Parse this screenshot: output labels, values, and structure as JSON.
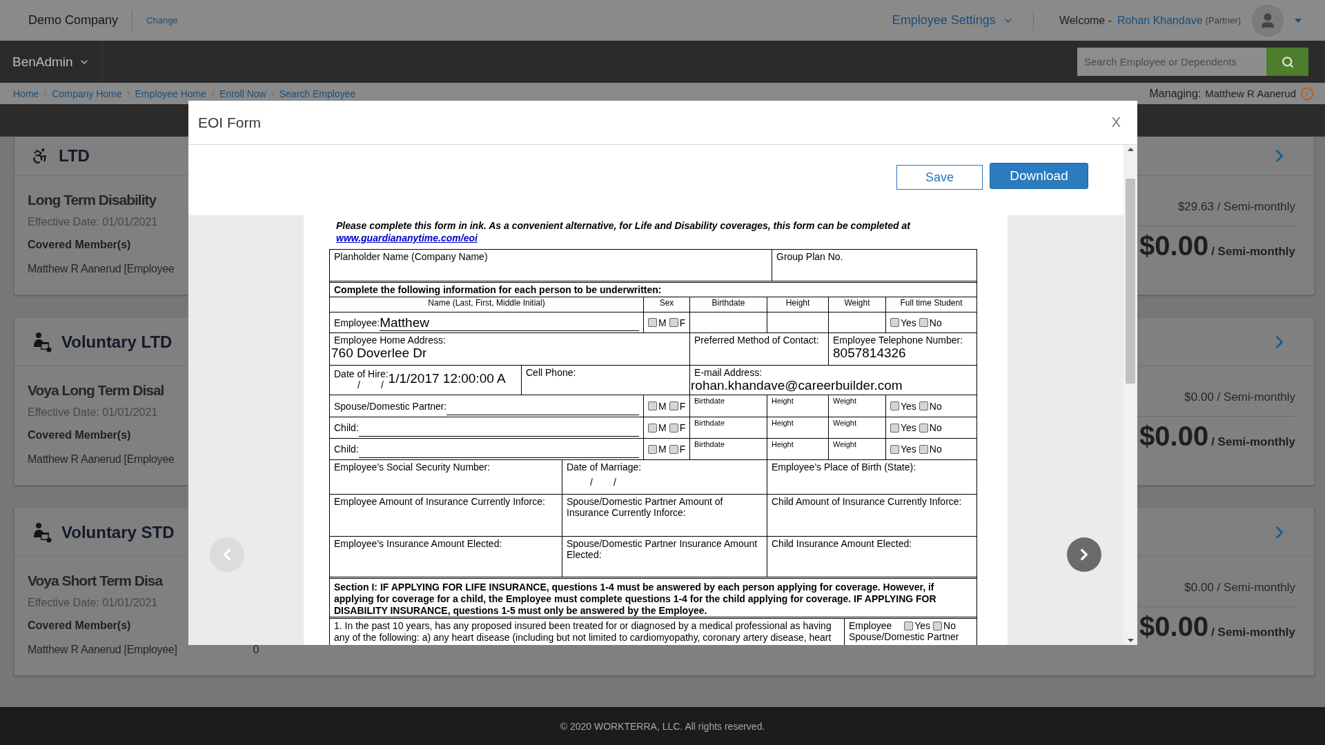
{
  "top_bar": {
    "company": "Demo Company",
    "change_link": "Change",
    "settings_menu": "Employee Settings",
    "welcome": "Welcome -",
    "user_name": "Rohan Khandave",
    "user_role": "(Partner)"
  },
  "nav_bar": {
    "app_menu": "BenAdmin",
    "search": {
      "placeholder": "Search Employee or Dependents"
    }
  },
  "breadcrumbs": [
    "Home",
    "Company Home",
    "Employee Home",
    "Enroll Now",
    "Search Employee"
  ],
  "managing": {
    "label": "Managing:",
    "name": "Matthew R Aanerud"
  },
  "plans": [
    {
      "category": "LTD",
      "plan_name": "Long Term Disability",
      "effective": "Effective Date: 01/01/2021",
      "members_heading": "Covered Member(s)",
      "member": "Matthew R Aanerud [Employee",
      "premium": "$29.63 / Semi-monthly",
      "contribution_amount": "$0.00",
      "contribution_period": "/ Semi-monthly"
    },
    {
      "category": "Voluntary LTD",
      "plan_name": "Voya Long Term Disal",
      "effective": "Effective Date: 01/01/2021",
      "members_heading": "Covered Member(s)",
      "member": "Matthew R Aanerud [Employee",
      "premium": "$0.00 / Semi-monthly",
      "contribution_amount": "$0.00",
      "contribution_period": "/ Semi-monthly"
    },
    {
      "category": "Voluntary STD",
      "plan_name": "Voya Short Term Disa",
      "effective": "Effective Date: 01/01/2021",
      "members_heading": "Covered Member(s)",
      "member": "Matthew R Aanerud [Employee]",
      "member_value": "0",
      "premium": "$0.00 / Semi-monthly",
      "contribution_amount": "$0.00",
      "contribution_period": "/ Semi-monthly"
    }
  ],
  "modal": {
    "title": "EOI Form",
    "close": "X",
    "save": "Save",
    "download": "Download",
    "form": {
      "intro": "Please complete this form in ink.  As a convenient alternative, for Life and Disability coverages, this form can be completed at",
      "link": "www.guardiananytime.com/eoi",
      "planholder_label": "Planholder Name (Company Name)",
      "group_plan_label": "Group Plan No.",
      "persons_heading": "Complete the following information for each person to be underwritten:",
      "columns": [
        "Name (Last, First, Middle Initial)",
        "Sex",
        "Birthdate",
        "Height",
        "Weight",
        "Full time Student"
      ],
      "employee": {
        "label": "Employee:",
        "name": "Matthew",
        "sex": [
          {
            "label": "M",
            "checked": false
          },
          {
            "label": "F",
            "checked": false
          }
        ],
        "student": [
          {
            "label": "Yes",
            "checked": false
          },
          {
            "label": "No",
            "checked": false
          }
        ]
      },
      "address_label": "Employee Home Address:",
      "address": "760 Doverlee Dr",
      "contact_label": "Preferred Method of Contact:",
      "phone_label": "Employee Telephone Number:",
      "phone": "8057814326",
      "hire_label": "Date of Hire:",
      "hire_marks": [
        "/",
        "/"
      ],
      "hire_date": "1/1/2017 12:00:00 A",
      "cell_label": "Cell Phone:",
      "email_label": "E-mail Address:",
      "email": "rohan.khandave@careerbuilder.com",
      "dependents": [
        {
          "label": "Spouse/Domestic Partner:",
          "sex": [
            {
              "label": "M",
              "checked": false
            },
            {
              "label": "F",
              "checked": false
            }
          ],
          "fields": [
            "Birthdate",
            "Height",
            "Weight"
          ],
          "student": [
            {
              "label": "Yes",
              "checked": false
            },
            {
              "label": "No",
              "checked": false
            }
          ]
        },
        {
          "label": "Child:",
          "sex": [
            {
              "label": "M",
              "checked": false
            },
            {
              "label": "F",
              "checked": false
            }
          ],
          "fields": [
            "Birthdate",
            "Height",
            "Weight"
          ],
          "student": [
            {
              "label": "Yes",
              "checked": false
            },
            {
              "label": "No",
              "checked": false
            }
          ]
        },
        {
          "label": "Child:",
          "sex": [
            {
              "label": "M",
              "checked": false
            },
            {
              "label": "F",
              "checked": false
            }
          ],
          "fields": [
            "Birthdate",
            "Height",
            "Weight"
          ],
          "student": [
            {
              "label": "Yes",
              "checked": false
            },
            {
              "label": "No",
              "checked": false
            }
          ]
        }
      ],
      "info_rows": [
        [
          {
            "label": "Employee’s Social Security Number:"
          },
          {
            "label": "Date of Marriage:",
            "marks": [
              "/",
              "/"
            ]
          },
          {
            "label": "Employee’s Place of Birth (State):"
          }
        ],
        [
          {
            "label": "Employee Amount of Insurance Currently Inforce:"
          },
          {
            "label": "Spouse/Domestic Partner Amount of Insurance Currently Inforce:"
          },
          {
            "label": "Child Amount of Insurance Currently Inforce:"
          }
        ],
        [
          {
            "label": "Employee’s Insurance Amount Elected:"
          },
          {
            "label": "Spouse/Domestic Partner Insurance Amount Elected:"
          },
          {
            "label": "Child Insurance Amount Elected:"
          }
        ]
      ],
      "section_heading": "Section I: IF APPLYING FOR LIFE INSURANCE, questions 1-4 must be answered by each person applying for coverage.  However, if applying for coverage for a child, the Employee must complete questions 1-4 for the child applying for coverage. IF APPLYING FOR DISABILITY INSURANCE, questions 1-5 must only be answered by the Employee.",
      "questions": [
        {
          "number": "1.",
          "text": "In the past 10 years, has any proposed insured been treated for or diagnosed by a medical professional as having any of the following: a) any heart disease (including but not limited to cardiomyopathy, coronary artery disease, heart",
          "answers": [
            {
              "person": "Employee",
              "options": [
                {
                  "label": "Yes",
                  "checked": false
                },
                {
                  "label": "No",
                  "checked": false
                }
              ]
            },
            {
              "person": "Spouse/Domestic Partner"
            }
          ]
        }
      ]
    }
  },
  "footer": "© 2020 WORKTERRA, LLC. All rights reserved."
}
